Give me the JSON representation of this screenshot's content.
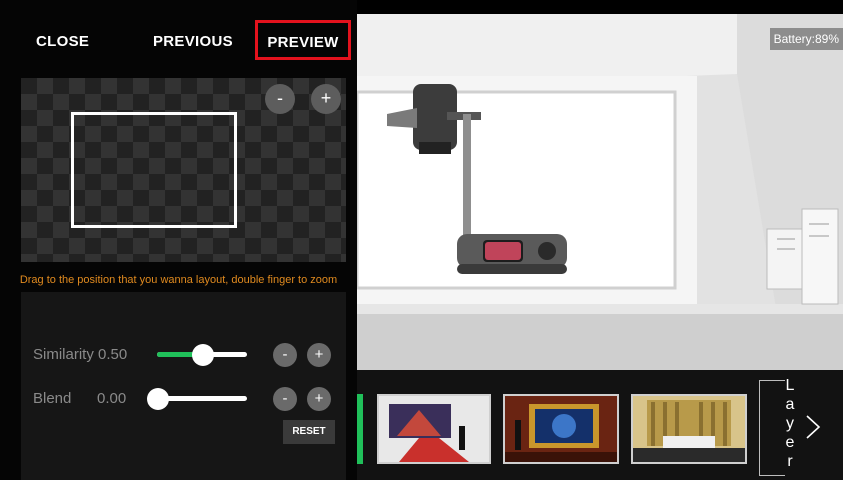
{
  "topbar": {
    "close": "CLOSE",
    "previous": "PREVIOUS",
    "preview": "PREVIEW"
  },
  "zoom": {
    "minus": "-",
    "plus": "+"
  },
  "hint": "Drag to the position that you wanna layout, double finger to zoom",
  "similarity": {
    "label": "Similarity 0.50",
    "level": 0.5
  },
  "blend": {
    "label": "Blend",
    "value": "0.00",
    "level": 0.0
  },
  "reset": "RESET",
  "status": {
    "battery": "Battery:89%"
  },
  "thumbnails": [
    "stage-red-carpet",
    "framed-earth-stage",
    "gold-curtain-desk"
  ],
  "layer": "Layer",
  "colors": {
    "accent_green": "#20c05a",
    "hint_orange": "#e08a1f",
    "preview_border": "#e3121d"
  }
}
